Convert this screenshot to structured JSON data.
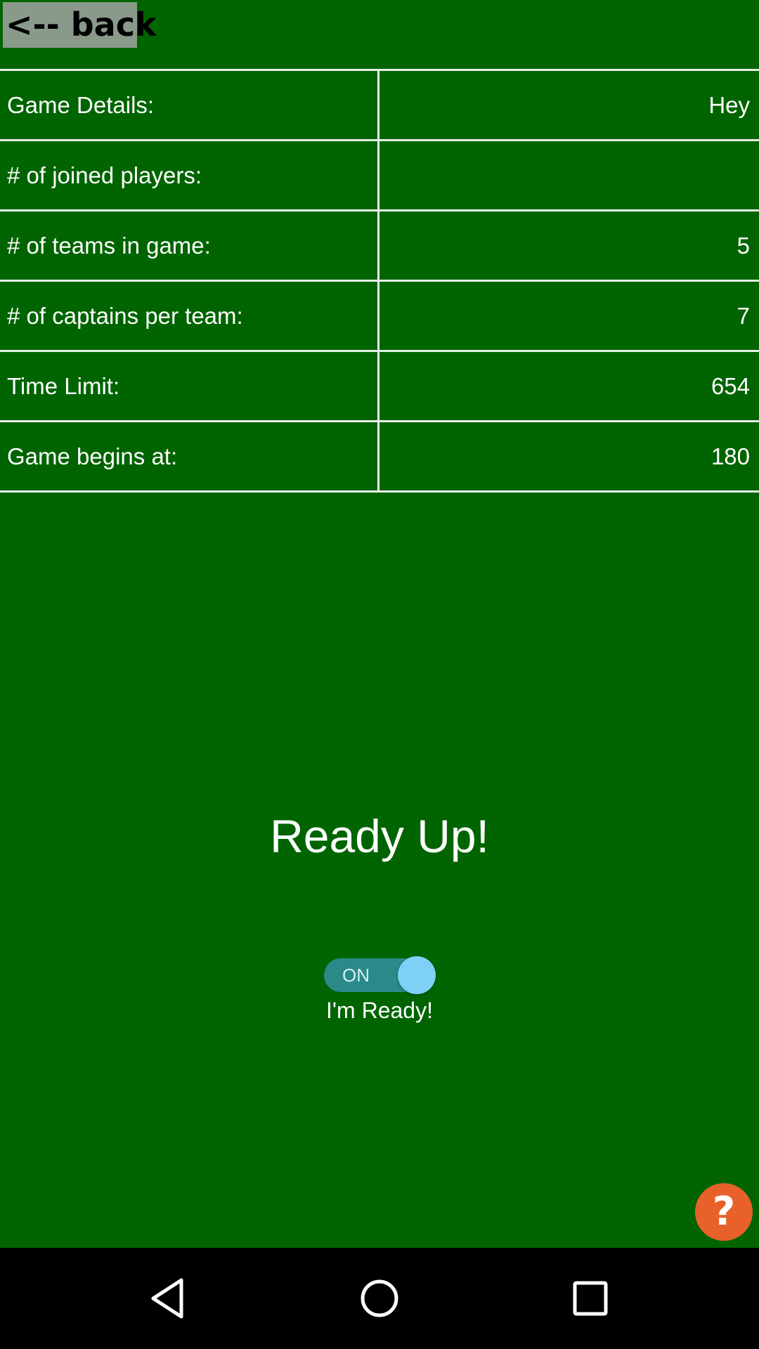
{
  "header": {
    "back_label": "<-- back"
  },
  "details": [
    {
      "label": "Game Details:",
      "value": "Hey"
    },
    {
      "label": "# of joined players:",
      "value": ""
    },
    {
      "label": "# of teams in game:",
      "value": "5"
    },
    {
      "label": "# of captains per team:",
      "value": "7"
    },
    {
      "label": "Time Limit:",
      "value": "654"
    },
    {
      "label": "Game begins at:",
      "value": "180"
    }
  ],
  "ready": {
    "title": "Ready Up!",
    "toggle_text": "ON",
    "toggle_state": true,
    "label": "I'm Ready!"
  },
  "help": {
    "icon": "question-icon",
    "glyph": "?"
  },
  "navbar": {
    "back_icon": "nav-back-icon",
    "home_icon": "nav-home-icon",
    "recents_icon": "nav-recents-icon"
  },
  "colors": {
    "background": "#006400",
    "help_button": "#e8612a",
    "toggle_track": "#2a8a8a",
    "toggle_knob": "#7fd0f5"
  }
}
